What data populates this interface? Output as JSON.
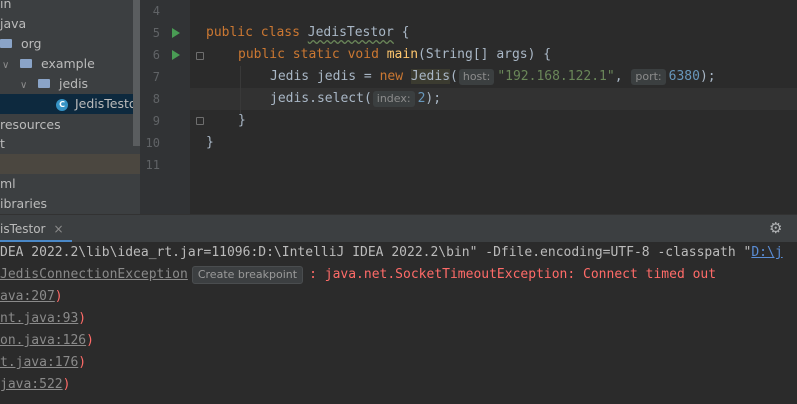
{
  "tree": {
    "items": [
      {
        "label": "in",
        "type": "text"
      },
      {
        "label": "java",
        "type": "text"
      },
      {
        "label": "org",
        "type": "folder"
      },
      {
        "label": "example",
        "type": "folder"
      },
      {
        "label": "jedis",
        "type": "folder"
      },
      {
        "label": "JedisTestor",
        "type": "class"
      },
      {
        "label": "resources",
        "type": "text"
      },
      {
        "label": "t",
        "type": "text"
      },
      {
        "label": "",
        "type": "text"
      },
      {
        "label": "ml",
        "type": "text"
      },
      {
        "label": "ibraries",
        "type": "text"
      }
    ]
  },
  "editor": {
    "line_numbers": [
      "4",
      "5",
      "6",
      "7",
      "8",
      "9",
      "10",
      "11"
    ],
    "code": {
      "l5_public": "public",
      "l5_class": "class",
      "l5_name": "JedisTestor",
      "l5_brace": " {",
      "l6_public": "public",
      "l6_static": "static",
      "l6_void": "void",
      "l6_main": "main",
      "l6_args": "(String[] args) {",
      "l7_decl": "Jedis jedis = ",
      "l7_new": "new",
      "l7_type": "Jedis",
      "l7_paren": "(",
      "l7_hint_host": "host:",
      "l7_str": "\"192.168.122.1\"",
      "l7_comma": ",",
      "l7_hint_port": "port:",
      "l7_num": "6380",
      "l7_end": ");",
      "l8_obj": "jedis.",
      "l8_select": "select",
      "l8_paren": "(",
      "l8_hint_index": "index:",
      "l8_num": "2",
      "l8_end": ");",
      "l9": "}",
      "l10": "}"
    }
  },
  "run_panel": {
    "tab_label": "isTestor",
    "close_glyph": "×",
    "gear_glyph": "⚙",
    "console": {
      "line1_text": "DEA 2022.2\\lib\\idea_rt.jar=11096:D:\\IntelliJ IDEA 2022.2\\bin\" -Dfile.encoding=UTF-8 -classpath \"",
      "line1_link": "D:\\j",
      "line2_link": "JedisConnectionException",
      "line2_chip": "Create breakpoint",
      "line2_err": ": java.net.SocketTimeoutException: Connect timed out",
      "trace": [
        {
          "link": "ava:207",
          "tail": ")"
        },
        {
          "link": "nt.java:93",
          "tail": ")"
        },
        {
          "link": "on.java:126",
          "tail": ")"
        },
        {
          "link": "t.java:176",
          "tail": ")"
        },
        {
          "link": "java:522",
          "tail": ")"
        }
      ]
    }
  },
  "colors": {
    "keyword": "#cc7832",
    "method": "#ffc66d",
    "string": "#6a8759",
    "number": "#6897bb",
    "error": "#ff6b68",
    "link": "#5a8dd6",
    "run_icon": "#499c54"
  }
}
